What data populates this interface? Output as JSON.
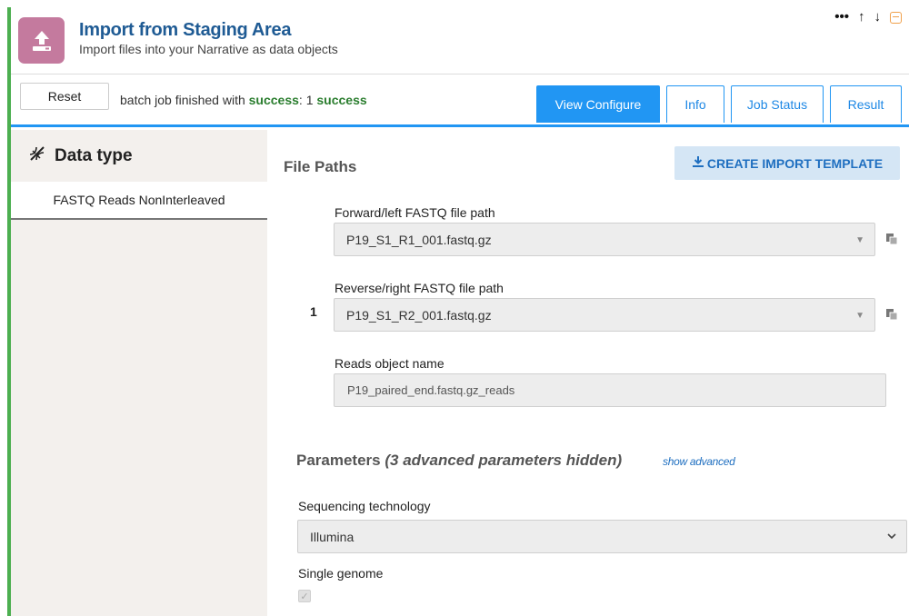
{
  "header": {
    "title": "Import from Staging Area",
    "subtitle": "Import files into your Narrative as data objects",
    "icon": "upload-icon",
    "controls": [
      "more-icon",
      "arrow-up-icon",
      "arrow-down-icon",
      "collapse-icon"
    ],
    "more_label": "•••",
    "up_label": "↑",
    "down_label": "↓"
  },
  "toolbar": {
    "reset_label": "Reset",
    "status_prefix": "batch job finished with ",
    "status_success": "success",
    "status_colon": ": 1 ",
    "status_count": "success",
    "tabs": [
      {
        "label": "View Configure",
        "active": true
      },
      {
        "label": "Info",
        "active": false
      },
      {
        "label": "Job Status",
        "active": false
      },
      {
        "label": "Result",
        "active": false
      }
    ]
  },
  "sidebar": {
    "title": "Data type",
    "icon": "dna-icon",
    "items": [
      {
        "label": "FASTQ Reads NonInterleaved"
      }
    ]
  },
  "file_paths": {
    "title": "File Paths",
    "template_button": "CREATE IMPORT TEMPLATE",
    "row_number": "1",
    "forward_label": "Forward/left FASTQ file path",
    "forward_value": "P19_S1_R1_001.fastq.gz",
    "reverse_label": "Reverse/right FASTQ file path",
    "reverse_value": "P19_S1_R2_001.fastq.gz",
    "reads_label": "Reads object name",
    "reads_value": "P19_paired_end.fastq.gz_reads"
  },
  "parameters": {
    "title": "Parameters",
    "hidden_note": "(3 advanced parameters hidden)",
    "show_advanced": "show advanced",
    "seq_tech_label": "Sequencing technology",
    "seq_tech_value": "Illumina",
    "single_genome_label": "Single genome",
    "single_genome_checked": true
  },
  "colors": {
    "accent_green": "#4caf50",
    "primary_blue": "#2196f3",
    "title_blue": "#1f5b94",
    "app_icon_bg": "#c47a9e",
    "success_green": "#2a7d2e"
  }
}
